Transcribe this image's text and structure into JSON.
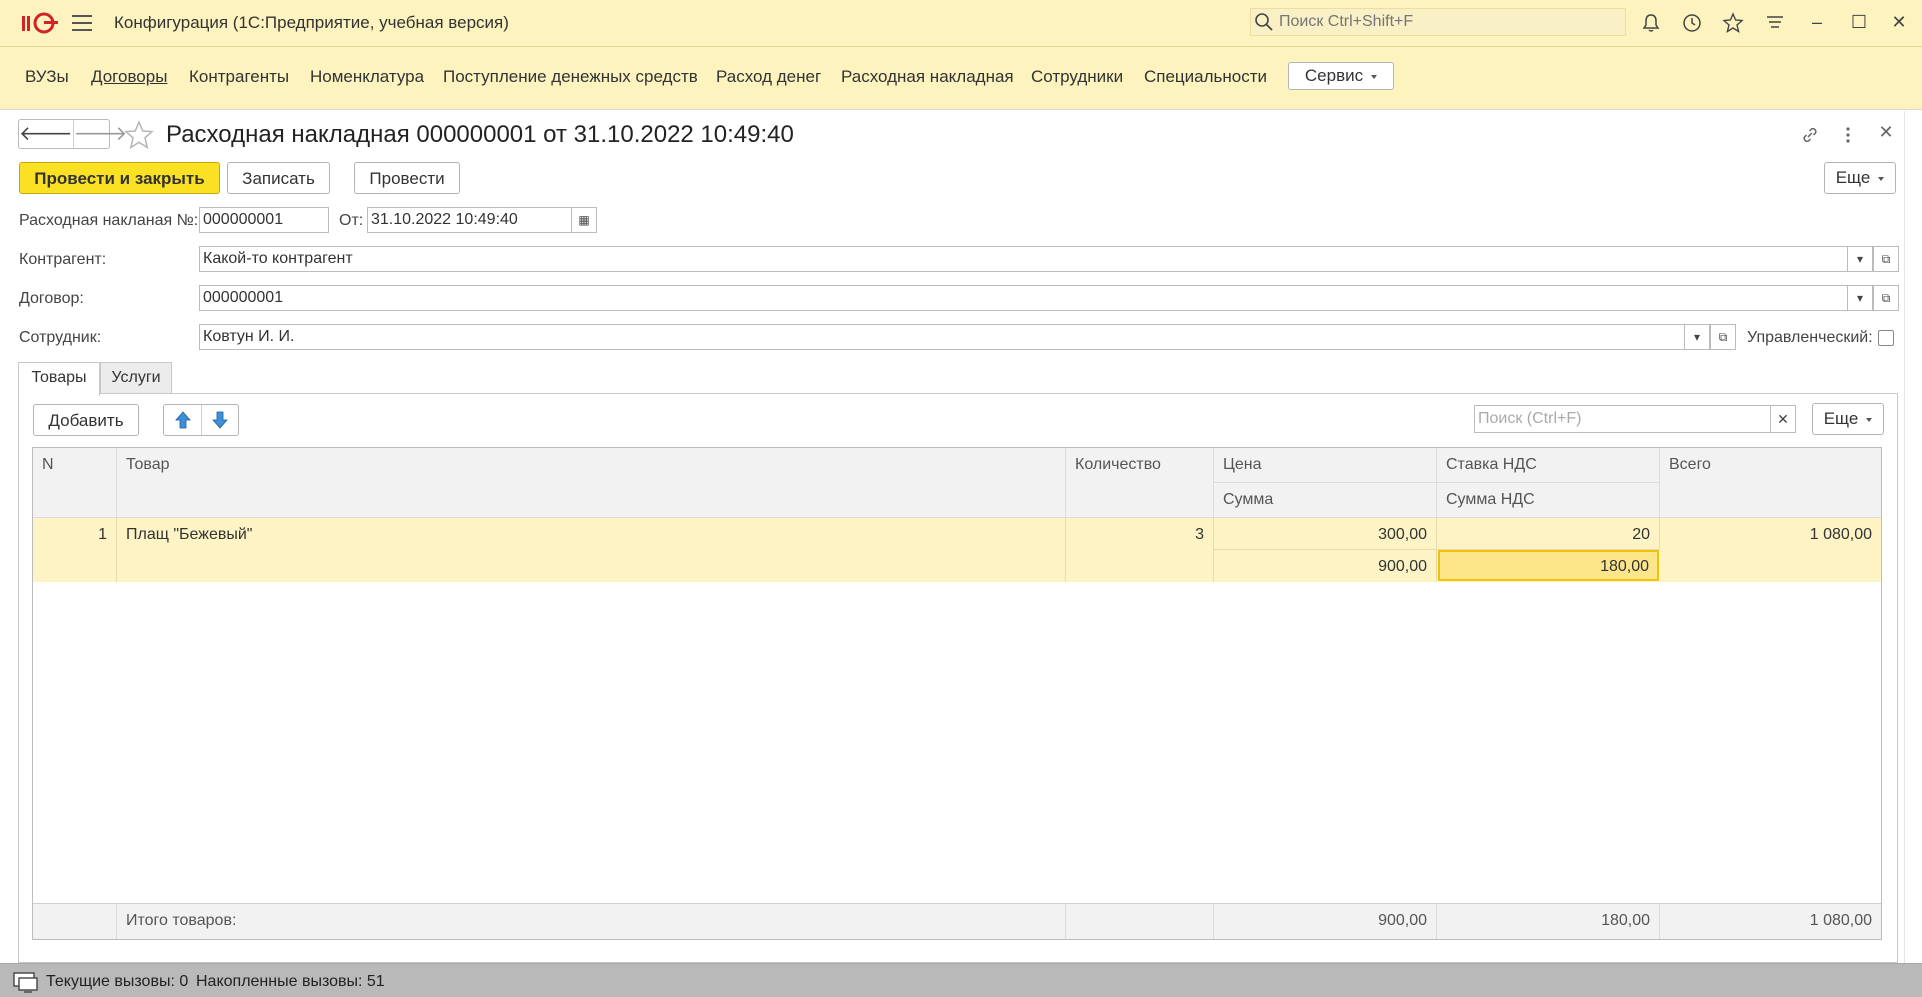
{
  "app": {
    "title": "Конфигурация  (1С:Предприятие, учебная версия)",
    "search_placeholder": "Поиск Ctrl+Shift+F",
    "logo_text": "1С"
  },
  "nav": {
    "items": [
      {
        "label": "ВУЗы"
      },
      {
        "label": "Договоры"
      },
      {
        "label": "Контрагенты"
      },
      {
        "label": "Номенклатура"
      },
      {
        "label": "Поступление денежных средств"
      },
      {
        "label": "Расход денег"
      },
      {
        "label": "Расходная накладная"
      },
      {
        "label": "Сотрудники"
      },
      {
        "label": "Специальности"
      }
    ],
    "service_label": "Сервис"
  },
  "document": {
    "title": "Расходная накладная 000000001 от 31.10.2022 10:49:40",
    "buttons": {
      "post_close": "Провести и закрыть",
      "save": "Записать",
      "post": "Провести",
      "more": "Еще"
    },
    "fields": {
      "number_label": "Расходная накланая №:",
      "number_value": "000000001",
      "date_label": "От:",
      "date_value": "31.10.2022 10:49:40",
      "counterparty_label": "Контрагент:",
      "counterparty_value": "Какой-то контрагент",
      "contract_label": "Договор:",
      "contract_value": "000000001",
      "employee_label": "Сотрудник:",
      "employee_value": "Ковтун И. И.",
      "managerial_label": "Управленческий:"
    },
    "tabs": [
      {
        "label": "Товары"
      },
      {
        "label": "Услуги"
      }
    ]
  },
  "table": {
    "add_label": "Добавить",
    "search_placeholder": "Поиск (Ctrl+F)",
    "more_label": "Еще",
    "headers": {
      "n": "N",
      "product": "Товар",
      "qty": "Количество",
      "price": "Цена",
      "sum": "Сумма",
      "vat_rate": "Ставка НДС",
      "vat_sum": "Сумма НДС",
      "total": "Всего"
    },
    "rows": [
      {
        "n": "1",
        "product": "Плащ \"Бежевый\"",
        "qty": "3",
        "price": "300,00",
        "sum": "900,00",
        "vat_rate": "20",
        "vat_sum": "180,00",
        "total": "1 080,00"
      }
    ],
    "footer": {
      "label": "Итого товаров:",
      "sum": "900,00",
      "vat_sum": "180,00",
      "total": "1 080,00"
    }
  },
  "status": {
    "current_calls": "Текущие вызовы: 0",
    "accumulated_calls": "Накопленные вызовы: 51"
  }
}
